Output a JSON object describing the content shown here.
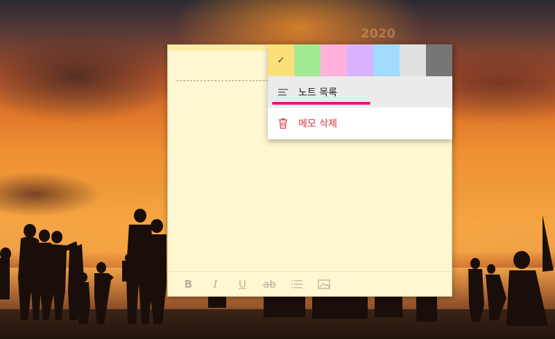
{
  "wallpaper": {
    "watermark": "2020"
  },
  "note": {
    "body_text": "",
    "toolbar": {
      "bold_label": "B",
      "italic_label": "I",
      "underline_label": "U",
      "strikethrough_label": "ab",
      "bullets_icon": "bullets-icon",
      "image_icon": "image-icon"
    }
  },
  "menu": {
    "colors": [
      {
        "name": "yellow",
        "hex": "#fbe07a",
        "selected": true
      },
      {
        "name": "green",
        "hex": "#a4ea92",
        "selected": false
      },
      {
        "name": "pink",
        "hex": "#ffb1dc",
        "selected": false
      },
      {
        "name": "purple",
        "hex": "#d9b3ff",
        "selected": false
      },
      {
        "name": "blue",
        "hex": "#9fdcff",
        "selected": false
      },
      {
        "name": "gray",
        "hex": "#e0e0e0",
        "selected": false
      },
      {
        "name": "charcoal",
        "hex": "#767676",
        "selected": false
      }
    ],
    "check_glyph": "✓",
    "notes_list_label": "노트 목록",
    "delete_label": "메모 삭제",
    "highlight_color": "#e5177a",
    "delete_color": "#d13438"
  }
}
